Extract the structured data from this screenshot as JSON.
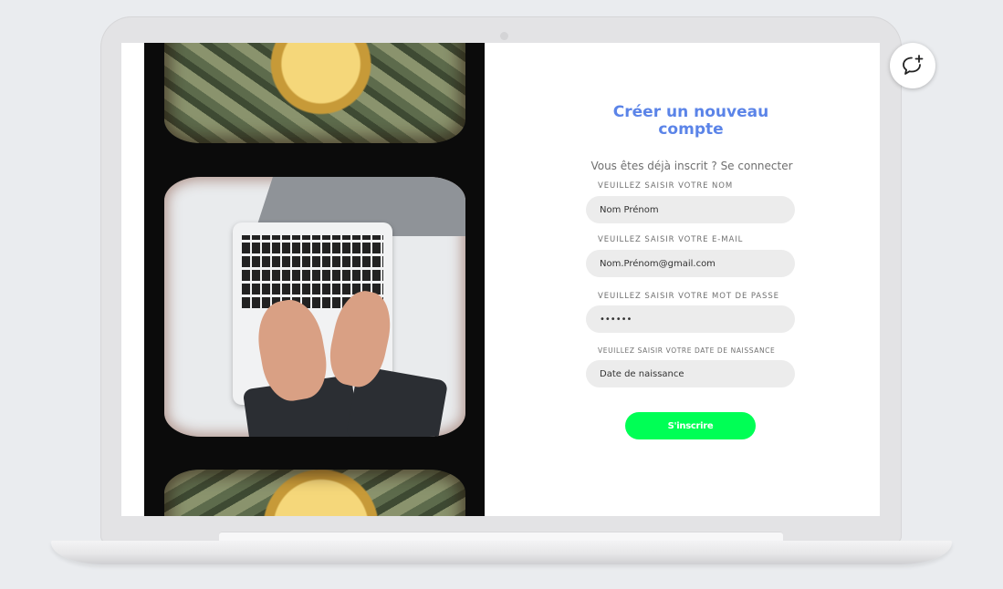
{
  "form": {
    "title": "Créer un nouveau compte",
    "login_prompt": "Vous êtes déjà inscrit ?",
    "login_link": "Se connecter",
    "fields": [
      {
        "label": "VEUILLEZ SAISIR VOTRE NOM",
        "value": "Nom Prénom"
      },
      {
        "label": "VEUILLEZ SAISIR VOTRE E-MAIL",
        "value": "Nom.Prénom@gmail.com"
      },
      {
        "label": "VEUILLEZ SAISIR VOTRE MOT DE PASSE",
        "value": "••••••"
      },
      {
        "label": "VEUILLEZ SAISIR VOTRE DATE DE NAISSANCE",
        "value": "Date de naissance"
      }
    ],
    "submit_label": "S'inscrire"
  },
  "chat": {
    "icon": "chat-plus-icon"
  },
  "images": {
    "top": "money-dollar-coin-image",
    "middle": "laptop-typing-image",
    "bottom": "money-dollar-coin-image"
  },
  "colors": {
    "title": "#5b84e8",
    "submit": "#00ff55",
    "input_bg": "#ececec"
  }
}
